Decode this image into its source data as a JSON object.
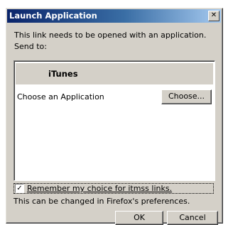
{
  "window": {
    "title": "Launch Application",
    "close_glyph": "✕"
  },
  "message": {
    "line1": "This link needs to be opened with an application.",
    "line2": "Send to:"
  },
  "app_list": {
    "selected_app": "iTunes",
    "choose_label": "Choose an Application",
    "choose_button": "Choose..."
  },
  "remember": {
    "checked": true,
    "check_glyph": "✓",
    "label": "Remember my choice for itmss links."
  },
  "note": "This can be changed in Firefox's preferences.",
  "buttons": {
    "ok": "OK",
    "cancel": "Cancel"
  }
}
